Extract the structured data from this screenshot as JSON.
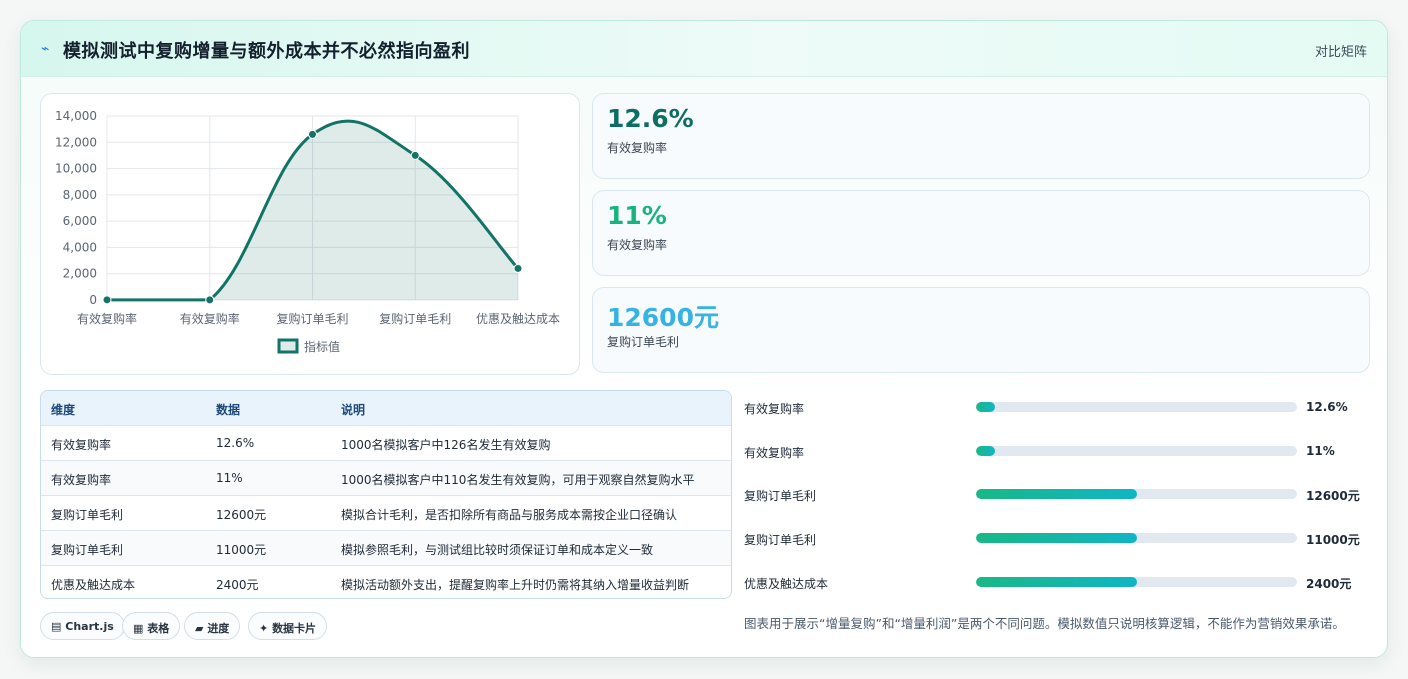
{
  "header": {
    "icon": "bolt-icon",
    "title": "模拟测试中复购增量与额外成本并不必然指向盈利",
    "link": "对比矩阵"
  },
  "chart_data": {
    "type": "line",
    "categories": [
      "有效复购率",
      "有效复购率",
      "复购订单毛利",
      "复购订单毛利",
      "优惠及触达成本"
    ],
    "series": [
      {
        "name": "指标值",
        "values": [
          12.6,
          11,
          12600,
          11000,
          2400
        ]
      }
    ],
    "ylim": [
      0,
      14000
    ],
    "yticks": [
      "0",
      "2,000",
      "4,000",
      "6,000",
      "8,000",
      "10,000",
      "12,000",
      "14,000"
    ],
    "grid": true,
    "legend": "bottom",
    "fill": true,
    "color": "#127366"
  },
  "kpis": [
    {
      "value": "12.6%",
      "label": "有效复购率",
      "color": "#0e6e63"
    },
    {
      "value": "11%",
      "label": "有效复购率",
      "color": "#18b47f"
    },
    {
      "value": "12600元",
      "label": "复购订单毛利",
      "color": "#36b3e3"
    }
  ],
  "table": {
    "headers": [
      "维度",
      "数据",
      "说明"
    ],
    "rows": [
      [
        "有效复购率",
        "12.6%",
        "1000名模拟客户中126名发生有效复购"
      ],
      [
        "有效复购率",
        "11%",
        "1000名模拟客户中110名发生有效复购，可用于观察自然复购水平"
      ],
      [
        "复购订单毛利",
        "12600元",
        "模拟合计毛利，是否扣除所有商品与服务成本需按企业口径确认"
      ],
      [
        "复购订单毛利",
        "11000元",
        "模拟参照毛利，与测试组比较时须保证订单和成本定义一致"
      ],
      [
        "优惠及触达成本",
        "2400元",
        "模拟活动额外支出，提醒复购率上升时仍需将其纳入增量收益判断"
      ]
    ]
  },
  "tags": [
    {
      "icon": "chart-icon",
      "glyph": "▤",
      "label": "Chart.js"
    },
    {
      "icon": "table-icon",
      "glyph": "▦",
      "label": "表格"
    },
    {
      "icon": "progress-icon",
      "glyph": "▰",
      "label": "进度"
    },
    {
      "icon": "sparkle-icon",
      "glyph": "✦",
      "label": "数据卡片"
    }
  ],
  "progress": [
    {
      "label": "有效复购率",
      "value": "12.6%",
      "fraction": 0.06
    },
    {
      "label": "有效复购率",
      "value": "11%",
      "fraction": 0.06
    },
    {
      "label": "复购订单毛利",
      "value": "12600元",
      "fraction": 0.5
    },
    {
      "label": "复购订单毛利",
      "value": "11000元",
      "fraction": 0.5
    },
    {
      "label": "优惠及触达成本",
      "value": "2400元",
      "fraction": 0.5
    }
  ],
  "note": "图表用于展示“增量复购”和“增量利润”是两个不同问题。模拟数值只说明核算逻辑，不能作为营销效果承诺。"
}
